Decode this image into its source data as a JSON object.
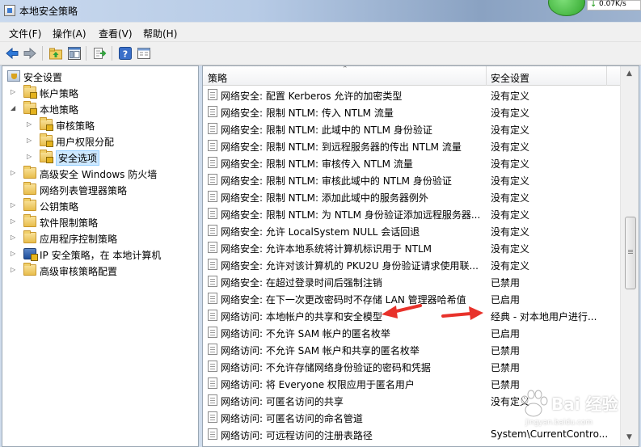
{
  "window": {
    "title": "本地安全策略",
    "net_speed": "0.07K/s"
  },
  "menu": [
    "文件(F)",
    "操作(A)",
    "查看(V)",
    "帮助(H)"
  ],
  "toolbar": {
    "icons": [
      "back-arrow-icon",
      "forward-arrow-icon",
      "up-folder-icon",
      "show-hide-tree-icon",
      "export-list-icon",
      "help-icon",
      "properties-icon"
    ]
  },
  "tree": {
    "items": [
      {
        "label": "安全设置",
        "level": 0,
        "expander": "",
        "icon": "security-settings-icon"
      },
      {
        "label": "帐户策略",
        "level": 1,
        "expander": "▷",
        "icon": "folder-icon"
      },
      {
        "label": "本地策略",
        "level": 1,
        "expander": "◢",
        "icon": "folder-icon"
      },
      {
        "label": "审核策略",
        "level": 2,
        "expander": "▷",
        "icon": "folder-icon"
      },
      {
        "label": "用户权限分配",
        "level": 2,
        "expander": "▷",
        "icon": "folder-icon"
      },
      {
        "label": "安全选项",
        "level": 2,
        "expander": "▷",
        "icon": "folder-icon",
        "selected": true
      },
      {
        "label": "高级安全 Windows 防火墙",
        "level": 1,
        "expander": "▷",
        "icon": "folder-icon"
      },
      {
        "label": "网络列表管理器策略",
        "level": 1,
        "expander": "",
        "icon": "folder-icon"
      },
      {
        "label": "公钥策略",
        "level": 1,
        "expander": "▷",
        "icon": "folder-icon"
      },
      {
        "label": "软件限制策略",
        "level": 1,
        "expander": "▷",
        "icon": "folder-icon"
      },
      {
        "label": "应用程序控制策略",
        "level": 1,
        "expander": "▷",
        "icon": "folder-icon"
      },
      {
        "label": "IP 安全策略，在 本地计算机",
        "level": 1,
        "expander": "▷",
        "icon": "ip-security-icon"
      },
      {
        "label": "高级审核策略配置",
        "level": 1,
        "expander": "▷",
        "icon": "folder-icon"
      }
    ]
  },
  "list": {
    "columns": [
      "策略",
      "安全设置"
    ],
    "rows": [
      {
        "policy": "网络安全: 配置 Kerberos 允许的加密类型",
        "setting": "没有定义"
      },
      {
        "policy": "网络安全: 限制 NTLM: 传入 NTLM 流量",
        "setting": "没有定义"
      },
      {
        "policy": "网络安全: 限制 NTLM: 此域中的 NTLM 身份验证",
        "setting": "没有定义"
      },
      {
        "policy": "网络安全: 限制 NTLM: 到远程服务器的传出 NTLM 流量",
        "setting": "没有定义"
      },
      {
        "policy": "网络安全: 限制 NTLM: 审核传入 NTLM 流量",
        "setting": "没有定义"
      },
      {
        "policy": "网络安全: 限制 NTLM: 审核此域中的 NTLM 身份验证",
        "setting": "没有定义"
      },
      {
        "policy": "网络安全: 限制 NTLM: 添加此域中的服务器例外",
        "setting": "没有定义"
      },
      {
        "policy": "网络安全: 限制 NTLM: 为 NTLM 身份验证添加远程服务器...",
        "setting": "没有定义"
      },
      {
        "policy": "网络安全: 允许 LocalSystem NULL 会话回退",
        "setting": "没有定义"
      },
      {
        "policy": "网络安全: 允许本地系统将计算机标识用于 NTLM",
        "setting": "没有定义"
      },
      {
        "policy": "网络安全: 允许对该计算机的 PKU2U 身份验证请求使用联...",
        "setting": "没有定义"
      },
      {
        "policy": "网络安全: 在超过登录时间后强制注销",
        "setting": "已禁用"
      },
      {
        "policy": "网络安全: 在下一次更改密码时不存储 LAN 管理器哈希值",
        "setting": "已启用"
      },
      {
        "policy": "网络访问: 本地帐户的共享和安全模型",
        "setting": "经典 - 对本地用户进行..."
      },
      {
        "policy": "网络访问: 不允许 SAM 帐户的匿名枚举",
        "setting": "已启用"
      },
      {
        "policy": "网络访问: 不允许 SAM 帐户和共享的匿名枚举",
        "setting": "已禁用"
      },
      {
        "policy": "网络访问: 不允许存储网络身份验证的密码和凭据",
        "setting": "已禁用"
      },
      {
        "policy": "网络访问: 将 Everyone 权限应用于匿名用户",
        "setting": "已禁用"
      },
      {
        "policy": "网络访问: 可匿名访问的共享",
        "setting": "没有定义"
      },
      {
        "policy": "网络访问: 可匿名访问的命名管道",
        "setting": ""
      },
      {
        "policy": "网络访问: 可远程访问的注册表路径",
        "setting": "System\\CurrentContro..."
      }
    ]
  },
  "watermark": {
    "text": "Bai 经验",
    "sub": "jingyan.baidu.com"
  }
}
